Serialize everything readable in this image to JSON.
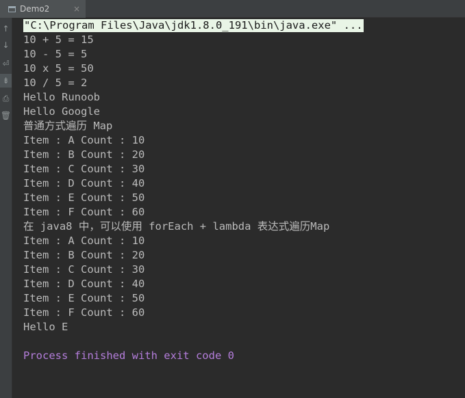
{
  "tab": {
    "title": "Demo2",
    "close_glyph": "×",
    "icon": "console-window-icon"
  },
  "gutter": {
    "icons": [
      {
        "name": "scroll-up-icon",
        "glyph": "↑"
      },
      {
        "name": "scroll-down-icon",
        "glyph": "↓"
      },
      {
        "name": "soft-wrap-icon",
        "glyph": "⏎"
      },
      {
        "name": "scroll-to-end-icon",
        "glyph": "⇟"
      },
      {
        "name": "print-icon",
        "glyph": "⎙"
      },
      {
        "name": "clear-all-icon",
        "glyph": "🗑"
      }
    ]
  },
  "console": {
    "command": "\"C:\\Program Files\\Java\\jdk1.8.0_191\\bin\\java.exe\" ...",
    "lines": [
      "10 + 5 = 15",
      "10 - 5 = 5",
      "10 x 5 = 50",
      "10 / 5 = 2",
      "Hello Runoob",
      "Hello Google",
      "普通方式遍历 Map",
      "Item : A Count : 10",
      "Item : B Count : 20",
      "Item : C Count : 30",
      "Item : D Count : 40",
      "Item : E Count : 50",
      "Item : F Count : 60",
      "在 java8 中，可以使用 forEach + lambda 表达式遍历Map",
      "Item : A Count : 10",
      "Item : B Count : 20",
      "Item : C Count : 30",
      "Item : D Count : 40",
      "Item : E Count : 50",
      "Item : F Count : 60",
      "Hello E",
      "",
      "Process finished with exit code 0"
    ]
  },
  "colors": {
    "background": "#2b2b2b",
    "text": "#bbbbbb",
    "command_highlight": "#e9f5e6",
    "process_finished": "#b57edc"
  }
}
